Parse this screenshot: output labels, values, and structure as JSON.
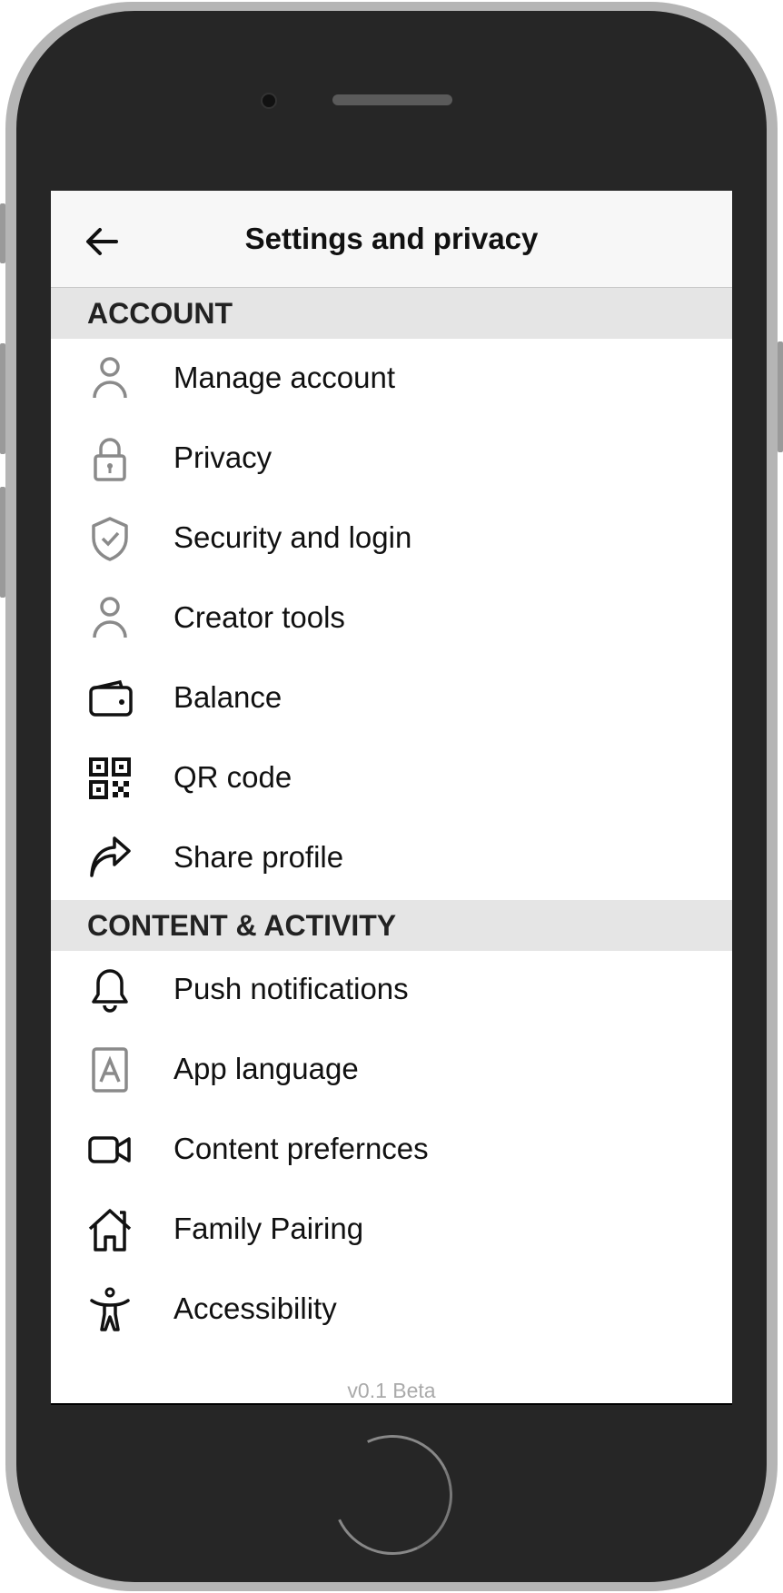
{
  "header": {
    "title": "Settings and privacy",
    "back_icon": "arrow-left-icon"
  },
  "sections": [
    {
      "title": "ACCOUNT",
      "items": [
        {
          "label": "Manage account",
          "icon": "person-icon"
        },
        {
          "label": "Privacy",
          "icon": "lock-icon"
        },
        {
          "label": "Security and login",
          "icon": "shield-check-icon"
        },
        {
          "label": "Creator tools",
          "icon": "person-icon"
        },
        {
          "label": "Balance",
          "icon": "wallet-icon"
        },
        {
          "label": "QR code",
          "icon": "qr-code-icon"
        },
        {
          "label": "Share profile",
          "icon": "share-arrow-icon"
        }
      ]
    },
    {
      "title": "CONTENT & ACTIVITY",
      "items": [
        {
          "label": "Push notifications",
          "icon": "bell-icon"
        },
        {
          "label": "App language",
          "icon": "language-icon"
        },
        {
          "label": "Content prefernces",
          "icon": "video-camera-icon"
        },
        {
          "label": "Family Pairing",
          "icon": "house-icon"
        },
        {
          "label": "Accessibility",
          "icon": "accessibility-icon"
        }
      ]
    }
  ],
  "footer": {
    "version": "v0.1 Beta"
  },
  "colors": {
    "header_bg": "#f7f7f7",
    "section_bg": "#e5e5e5",
    "gray_icon": "#8a8a8a",
    "phone_body": "#262626"
  }
}
